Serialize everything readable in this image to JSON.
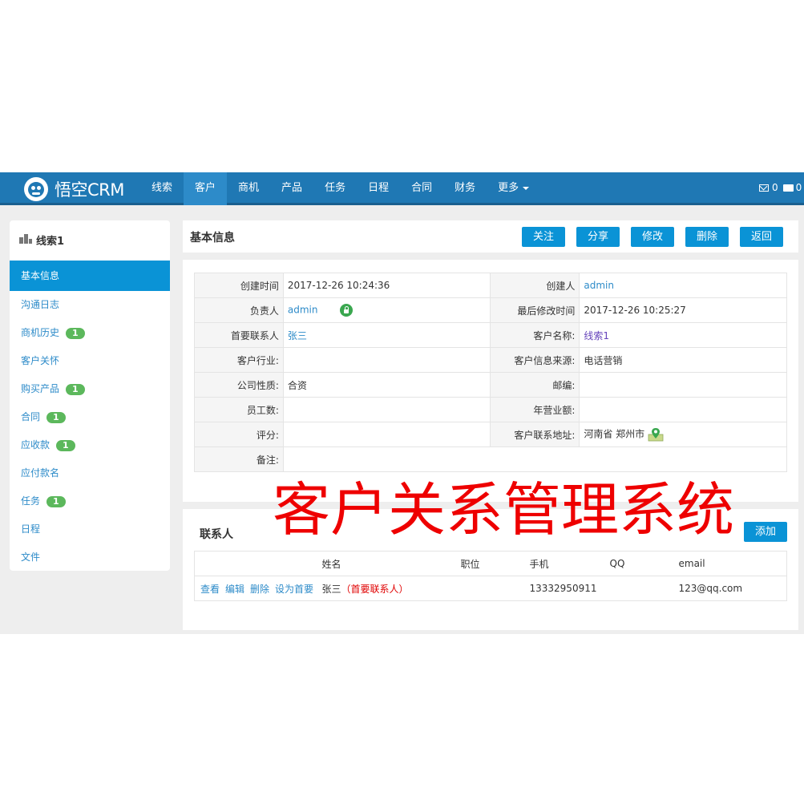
{
  "navbar": {
    "brand": "悟空CRM",
    "items": [
      {
        "label": "线索"
      },
      {
        "label": "客户"
      },
      {
        "label": "商机"
      },
      {
        "label": "产品"
      },
      {
        "label": "任务"
      },
      {
        "label": "日程"
      },
      {
        "label": "合同"
      },
      {
        "label": "财务"
      },
      {
        "label": "更多"
      }
    ],
    "active_item": "客户",
    "message_count": "0",
    "card_count": "0"
  },
  "sidebar": {
    "title": "线索1",
    "items": [
      {
        "label": "基本信息",
        "active": true
      },
      {
        "label": "沟通日志"
      },
      {
        "label": "商机历史",
        "badge": "1"
      },
      {
        "label": "客户关怀"
      },
      {
        "label": "购买产品",
        "badge": "1"
      },
      {
        "label": "合同",
        "badge": "1"
      },
      {
        "label": "应收款",
        "badge": "1"
      },
      {
        "label": "应付款名"
      },
      {
        "label": "任务",
        "badge": "1"
      },
      {
        "label": "日程"
      },
      {
        "label": "文件"
      }
    ]
  },
  "info": {
    "title": "基本信息",
    "buttons": {
      "follow": "关注",
      "share": "分享",
      "edit": "修改",
      "delete": "删除",
      "back": "返回"
    },
    "rows": [
      {
        "l1": "创建时间",
        "v1": "2017-12-26 10:24:36",
        "l2": "创建人",
        "v2": "admin"
      },
      {
        "l1": "负责人",
        "v1": "admin",
        "l2": "最后修改时间",
        "v2": "2017-12-26 10:25:27"
      },
      {
        "l1": "首要联系人",
        "v1": "张三",
        "l2": "客户名称:",
        "v2": "线索1"
      },
      {
        "l1": "客户行业:",
        "v1": "",
        "l2": "客户信息来源:",
        "v2": "电话营销"
      },
      {
        "l1": "公司性质:",
        "v1": "合资",
        "l2": "邮编:",
        "v2": ""
      },
      {
        "l1": "员工数:",
        "v1": "",
        "l2": "年营业额:",
        "v2": ""
      },
      {
        "l1": "评分:",
        "v1": "",
        "l2": "客户联系地址:",
        "v2": "河南省 郑州市"
      },
      {
        "l1": "备注:",
        "v1": ""
      }
    ]
  },
  "contacts": {
    "title": "联系人",
    "add_label": "添加",
    "columns": [
      "",
      "姓名",
      "职位",
      "手机",
      "QQ",
      "email"
    ],
    "rows": [
      {
        "actions": [
          "查看",
          "编辑",
          "删除",
          "设为首要"
        ],
        "name": "张三",
        "tag": "（首要联系人）",
        "position": "",
        "phone": "13332950911",
        "qq": "",
        "email": "123@qq.com"
      }
    ]
  },
  "watermark": "客户关系管理系统",
  "colors": {
    "navbar": "#1f78b4",
    "accent": "#0a93d6",
    "link": "#2d8bc9",
    "badge": "#5cb85c",
    "watermark": "#ee0000"
  },
  "icons": {
    "logo": "monkey-logo-icon",
    "mail": "envelope-icon",
    "card": "card-icon",
    "building": "building-icon",
    "lock": "unlock-icon",
    "map": "map-marker-icon"
  }
}
